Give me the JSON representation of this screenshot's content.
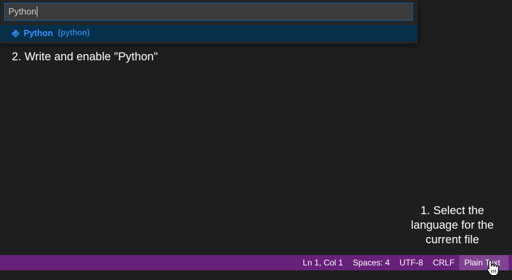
{
  "quick_pick": {
    "input_value": "Python",
    "items": [
      {
        "label": "Python",
        "id": "(python)",
        "icon": "python-icon"
      }
    ]
  },
  "annotations": {
    "step2": "2. Write and enable \"Python\"",
    "step1": "1. Select the language for the current file"
  },
  "status_bar": {
    "position": "Ln 1, Col 1",
    "indent": "Spaces: 4",
    "encoding": "UTF-8",
    "eol": "CRLF",
    "language": "Plain Text"
  },
  "colors": {
    "status_bar_bg": "#68217a",
    "selected_item_bg": "#062f4a",
    "item_label": "#3794ff",
    "editor_bg": "#1e1e1e"
  }
}
